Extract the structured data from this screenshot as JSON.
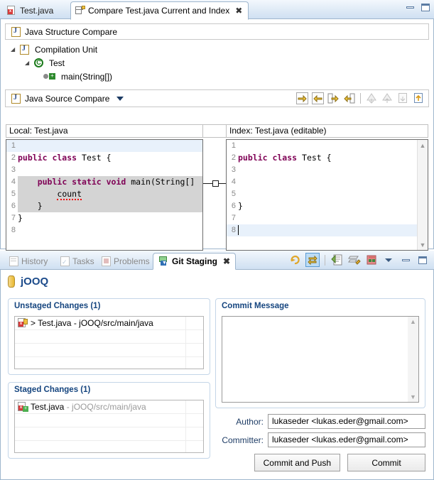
{
  "editor": {
    "tabs": [
      {
        "label": "Test.java",
        "icon": "java-file-error-icon",
        "active": false,
        "closable": false
      },
      {
        "label": "Compare Test.java Current and Index",
        "icon": "compare-icon",
        "active": true,
        "closable": true
      }
    ],
    "window_controls": {
      "minimize": "minimize-icon",
      "maximize": "maximize-icon"
    },
    "structure_compare": {
      "title": "Java Structure Compare",
      "tree": [
        {
          "label": "Compilation Unit",
          "depth": 0,
          "icon": "java-file-icon",
          "expanded": true
        },
        {
          "label": "Test",
          "depth": 1,
          "icon": "class-icon",
          "expanded": true
        },
        {
          "label": "main(String[])",
          "depth": 2,
          "icon": "method-icon",
          "expanded": null
        }
      ]
    },
    "source_compare": {
      "title": "Java Source Compare",
      "menu_icon": "chevron-down-icon",
      "toolbar": [
        {
          "name": "copy-all-left-to-right-icon",
          "enabled": true
        },
        {
          "name": "copy-all-right-to-left-icon",
          "enabled": true
        },
        {
          "name": "copy-current-change-left-to-right-icon",
          "enabled": true
        },
        {
          "name": "copy-current-change-right-to-left-icon",
          "enabled": true
        },
        {
          "name": "next-difference-icon",
          "enabled": false
        },
        {
          "name": "previous-difference-icon",
          "enabled": false
        },
        {
          "name": "next-change-icon",
          "enabled": false
        },
        {
          "name": "previous-change-icon",
          "enabled": true
        }
      ],
      "left": {
        "title": "Local: Test.java",
        "lines": [
          {
            "num": "1",
            "text": "",
            "diff": false,
            "current": true
          },
          {
            "num": "2",
            "text": "public class Test {",
            "diff": false,
            "current": false
          },
          {
            "num": "3",
            "text": "",
            "diff": false,
            "current": false
          },
          {
            "num": "4",
            "text": "    public static void main(String[]",
            "diff": true,
            "current": false
          },
          {
            "num": "5",
            "text": "        count",
            "diff": true,
            "current": false
          },
          {
            "num": "6",
            "text": "    }",
            "diff": true,
            "current": false
          },
          {
            "num": "7",
            "text": "}",
            "diff": false,
            "current": false
          },
          {
            "num": "8",
            "text": "",
            "diff": false,
            "current": false
          }
        ]
      },
      "right": {
        "title": "Index: Test.java (editable)",
        "lines": [
          {
            "num": "1",
            "text": "",
            "diff": false,
            "current": false
          },
          {
            "num": "2",
            "text": "public class Test {",
            "diff": false,
            "current": false
          },
          {
            "num": "3",
            "text": "",
            "diff": false,
            "current": false
          },
          {
            "num": "4",
            "text": "",
            "diff": false,
            "current": false
          },
          {
            "num": "5",
            "text": "",
            "diff": false,
            "current": false
          },
          {
            "num": "6",
            "text": "}",
            "diff": false,
            "current": false
          },
          {
            "num": "7",
            "text": "",
            "diff": false,
            "current": false
          },
          {
            "num": "8",
            "text": "",
            "diff": false,
            "current": true
          }
        ]
      }
    }
  },
  "git_staging": {
    "tabs": [
      {
        "label": "History",
        "icon": "history-icon",
        "active": false,
        "closable": false
      },
      {
        "label": "Tasks",
        "icon": "tasks-icon",
        "active": false,
        "closable": false
      },
      {
        "label": "Problems",
        "icon": "problems-icon",
        "active": false,
        "closable": false
      },
      {
        "label": "Git Staging",
        "icon": "git-staging-icon",
        "active": true,
        "closable": true
      }
    ],
    "toolbar": [
      {
        "name": "refresh-icon",
        "pressed": false
      },
      {
        "name": "toggle-staging-view-icon",
        "pressed": true
      },
      {
        "name": "open-commit-editor-icon",
        "pressed": false
      },
      {
        "name": "sign-off-icon",
        "pressed": false
      },
      {
        "name": "amend-commit-icon",
        "pressed": false
      },
      {
        "name": "view-menu-icon",
        "pressed": false
      },
      {
        "name": "minimize-icon",
        "pressed": false
      },
      {
        "name": "maximize-icon",
        "pressed": false
      }
    ],
    "repository": {
      "name": "jOOQ",
      "icon": "repository-icon"
    },
    "unstaged": {
      "title": "Unstaged Changes (1)",
      "rows": [
        {
          "prefix": "> ",
          "file": "Test.java",
          "path": " - jOOQ/src/main/java",
          "icon": "java-file-modified-icon",
          "gray_path": false
        }
      ],
      "empty_rows": 4
    },
    "staged": {
      "title": "Staged Changes (1)",
      "rows": [
        {
          "prefix": "",
          "file": "Test.java",
          "path": " - jOOQ/src/main/java",
          "icon": "java-file-added-icon",
          "gray_path": true
        }
      ],
      "empty_rows": 4
    },
    "commit": {
      "title": "Commit Message",
      "message_value": "",
      "author_label": "Author:",
      "author_value": "lukaseder <lukas.eder@gmail.com>",
      "committer_label": "Committer:",
      "committer_value": "lukaseder <lukas.eder@gmail.com>",
      "commit_and_push_label": "Commit and Push",
      "commit_label": "Commit"
    }
  },
  "colors": {
    "keyword": "#7f0055",
    "tab_active_bg": "#ffffff",
    "diff_highlight": "#d4d4d4",
    "current_line": "#e8f1fb",
    "group_title": "#15457f",
    "repo_name": "#1b4a8a"
  }
}
